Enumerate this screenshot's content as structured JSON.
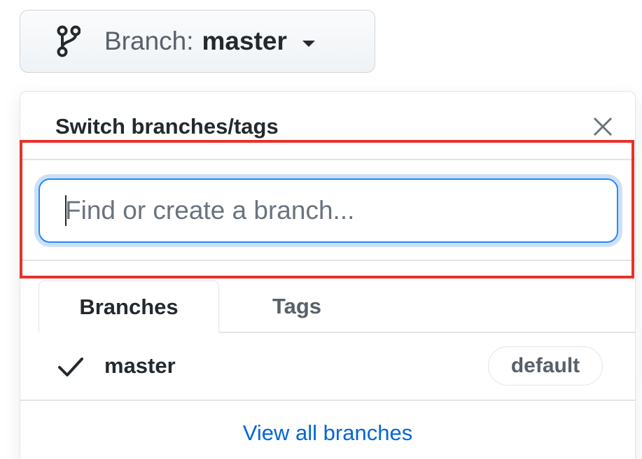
{
  "branch_button": {
    "prefix": "Branch:",
    "branch": "master",
    "icon": "git-branch-icon"
  },
  "dropdown": {
    "title": "Switch branches/tags",
    "close_icon": "close-icon",
    "search": {
      "placeholder": "Find or create a branch...",
      "value": ""
    },
    "tabs": [
      {
        "label": "Branches",
        "active": true
      },
      {
        "label": "Tags",
        "active": false
      }
    ],
    "branches": [
      {
        "name": "master",
        "checked": true,
        "badge": "default"
      }
    ],
    "view_all": "View all branches"
  },
  "highlight": {
    "target": "search-input",
    "color": "#e8312a"
  },
  "colors": {
    "accent": "#0366d6",
    "focus_ring": "#2188ff",
    "highlight": "#e8312a"
  }
}
